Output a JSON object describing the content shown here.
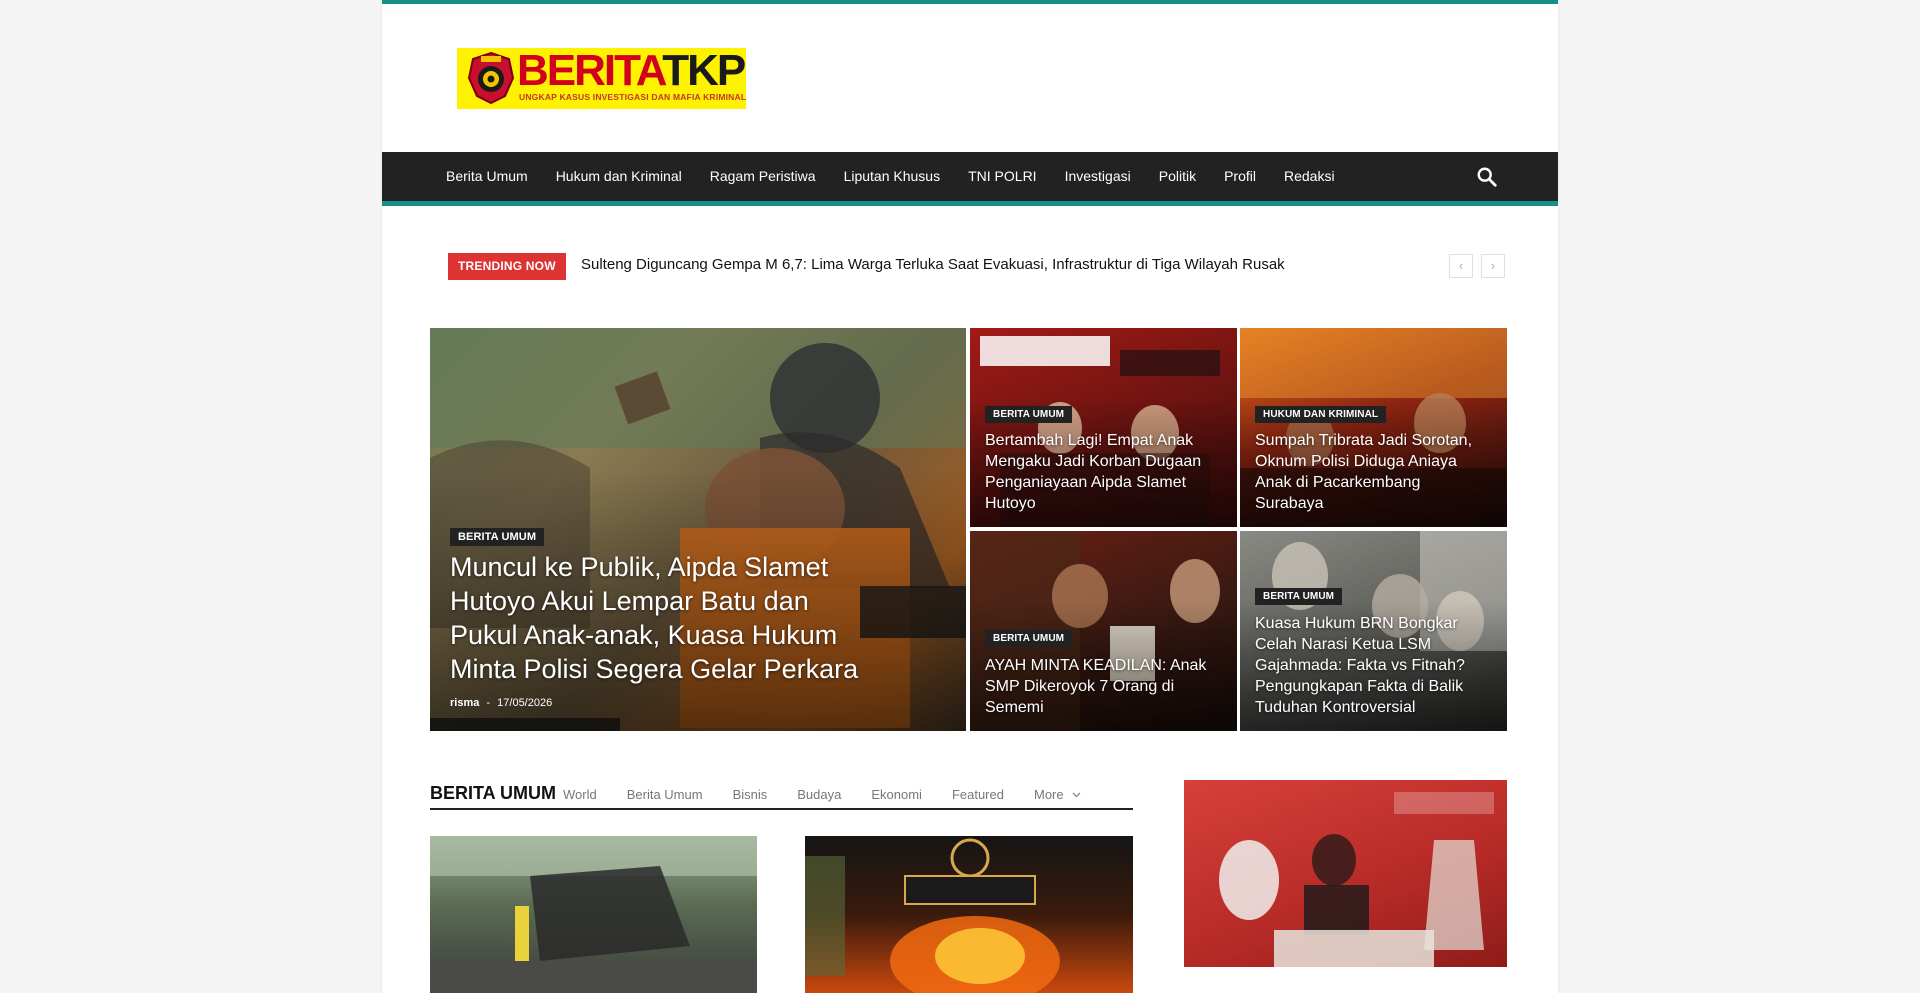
{
  "logo": {
    "word1": "BERITA",
    "word2": "TKP",
    "tagline": "UNGKAP KASUS INVESTIGASI DAN MAFIA KRIMINALITAS",
    "icon": "police-badge-icon"
  },
  "nav": {
    "items": [
      "Berita Umum",
      "Hukum dan Kriminal",
      "Ragam Peristiwa",
      "Liputan Khusus",
      "TNI POLRI",
      "Investigasi",
      "Politik",
      "Profil",
      "Redaksi"
    ],
    "search_icon": "search-icon"
  },
  "trending": {
    "label": "TRENDING NOW",
    "headline": "Sulteng Diguncang Gempa M 6,7: Lima Warga Terluka Saat Evakuasi, Infrastruktur di Tiga Wilayah Rusak",
    "prev": "‹",
    "next": "›"
  },
  "featured": {
    "main": {
      "category": "BERITA UMUM",
      "title": "Muncul ke Publik, Aipda Slamet Hutoyo Akui Lempar Batu dan Pukul Anak-anak, Kuasa Hukum Minta Polisi Segera Gelar Perkara",
      "author": "risma",
      "separator": "-",
      "date": "17/05/2026"
    },
    "tiles": [
      {
        "category": "BERITA UMUM",
        "title": "Bertambah Lagi! Empat Anak Mengaku Jadi Korban Dugaan Penganiayaan Aipda Slamet Hutoyo"
      },
      {
        "category": "HUKUM DAN KRIMINAL",
        "title": "Sumpah Tribrata Jadi Sorotan, Oknum Polisi Diduga Aniaya Anak di Pacarkembang Surabaya"
      },
      {
        "category": "BERITA UMUM",
        "title": "AYAH MINTA KEADILAN: Anak SMP Dikeroyok 7 Orang di Sememi"
      },
      {
        "category": "BERITA UMUM",
        "title": "Kuasa Hukum BRN Bongkar Celah Narasi Ketua LSM Gajahmada: Fakta vs Fitnah? Pengungkapan Fakta di Balik Tuduhan Kontroversial"
      }
    ]
  },
  "section": {
    "title": "BERITA UMUM",
    "tabs": [
      "World",
      "Berita Umum",
      "Bisnis",
      "Budaya",
      "Ekonomi",
      "Featured"
    ],
    "more": "More",
    "more_icon": "chevron-down-icon"
  },
  "colors": {
    "accent": "#139186",
    "nav_bg": "#222222",
    "trending": "#dd3333",
    "logo_bg": "#fff200"
  }
}
